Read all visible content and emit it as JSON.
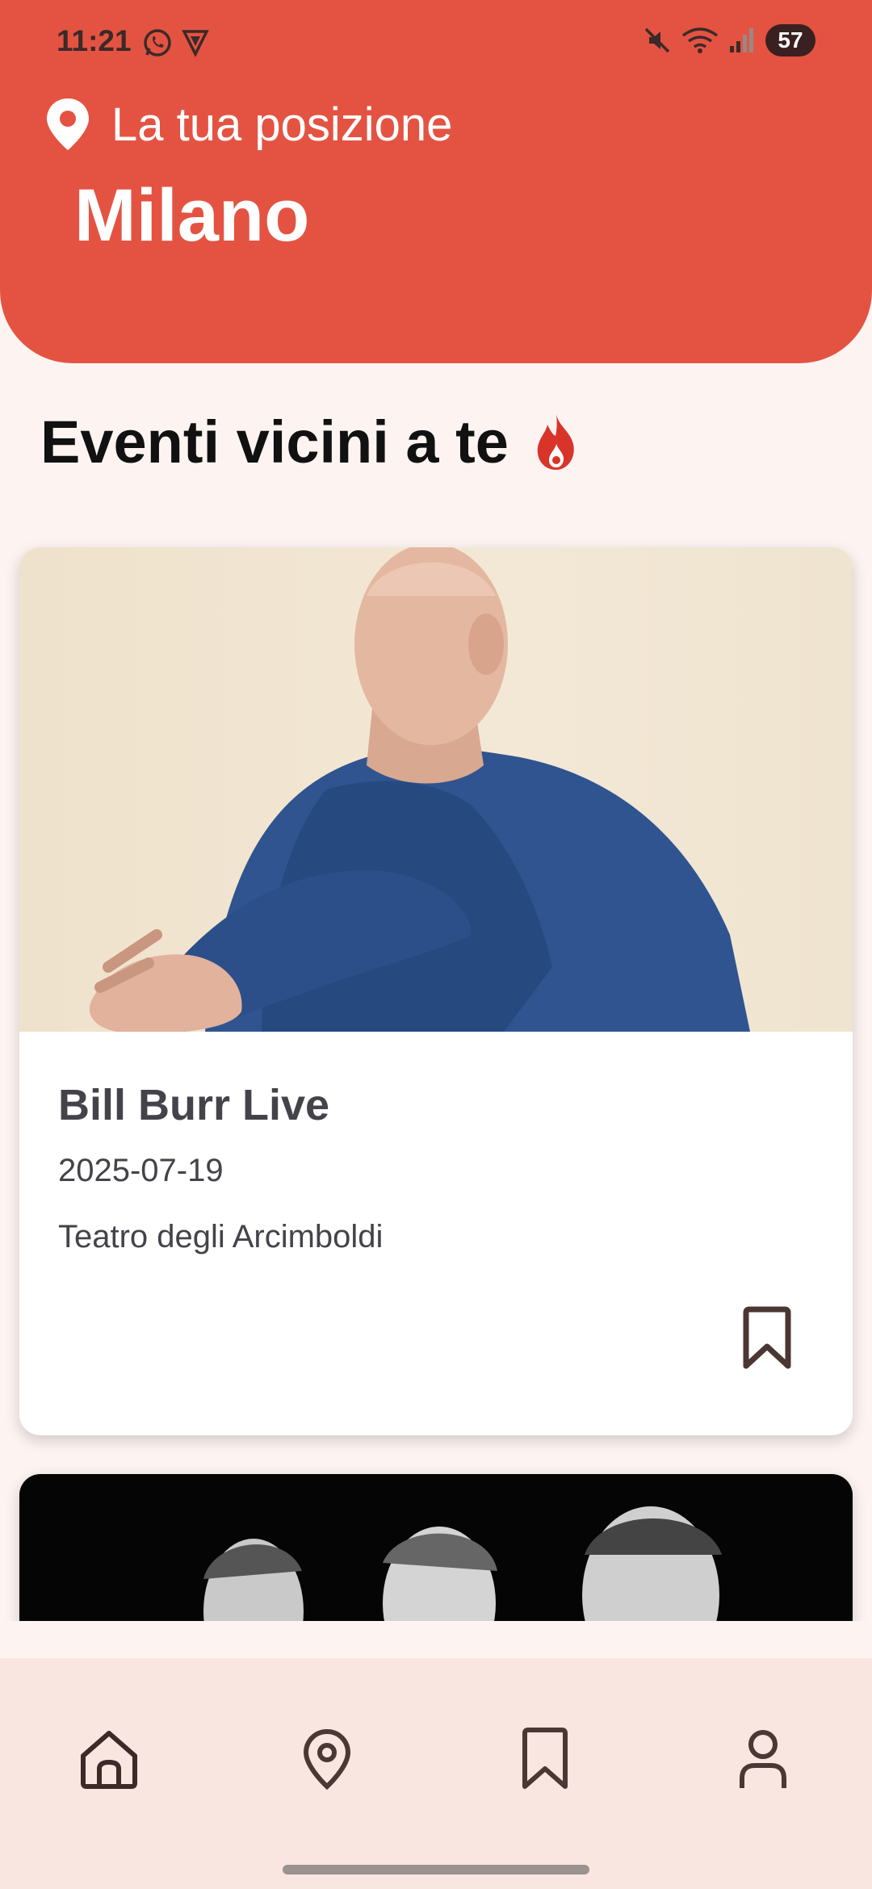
{
  "status_bar": {
    "time": "11:21",
    "battery": "57"
  },
  "header": {
    "location_label": "La tua posizione",
    "city": "Milano",
    "background_color": "#e45342"
  },
  "section": {
    "title": "Eventi vicini a te",
    "icon": "fire-icon"
  },
  "events": [
    {
      "title": "Bill Burr Live",
      "date": "2025-07-19",
      "venue": "Teatro degli Arcimboldi",
      "image": "photo-bill-burr",
      "bookmark_icon": "bookmark-icon"
    },
    {
      "image": "photo-three-men-black-white"
    }
  ],
  "bottom_nav": {
    "items": [
      {
        "icon": "home-icon"
      },
      {
        "icon": "location-pin-icon"
      },
      {
        "icon": "bookmark-icon"
      },
      {
        "icon": "user-icon"
      }
    ]
  }
}
